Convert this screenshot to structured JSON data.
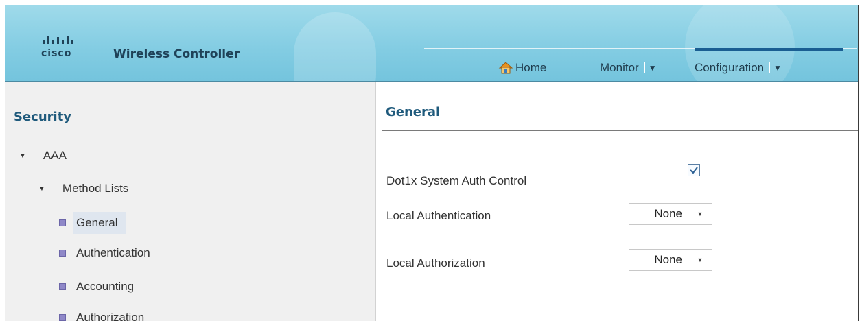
{
  "header": {
    "brand": "cisco",
    "product": "Wireless Controller",
    "nav": {
      "home": "Home",
      "monitor": "Monitor",
      "configuration": "Configuration",
      "active": "Configuration"
    }
  },
  "sidebar": {
    "title": "Security",
    "tree": {
      "aaa": "AAA",
      "method_lists": "Method Lists",
      "general": "General",
      "authentication": "Authentication",
      "accounting": "Accounting",
      "authorization_partial": "Authorization"
    },
    "selected": "General"
  },
  "content": {
    "title": "General",
    "fields": {
      "dot1x_label": "Dot1x System Auth Control",
      "dot1x_checked": true,
      "local_authentication_label": "Local Authentication",
      "local_authentication_value": "None",
      "local_authorization_label": "Local Authorization",
      "local_authorization_value": "None"
    }
  },
  "colors": {
    "header_top": "#9fdaea",
    "header_bottom": "#74c4dd",
    "title_blue": "#1f5a7c",
    "active_tab_bar": "#1a5e92",
    "selected_item_bg": "#dfe6ef"
  }
}
